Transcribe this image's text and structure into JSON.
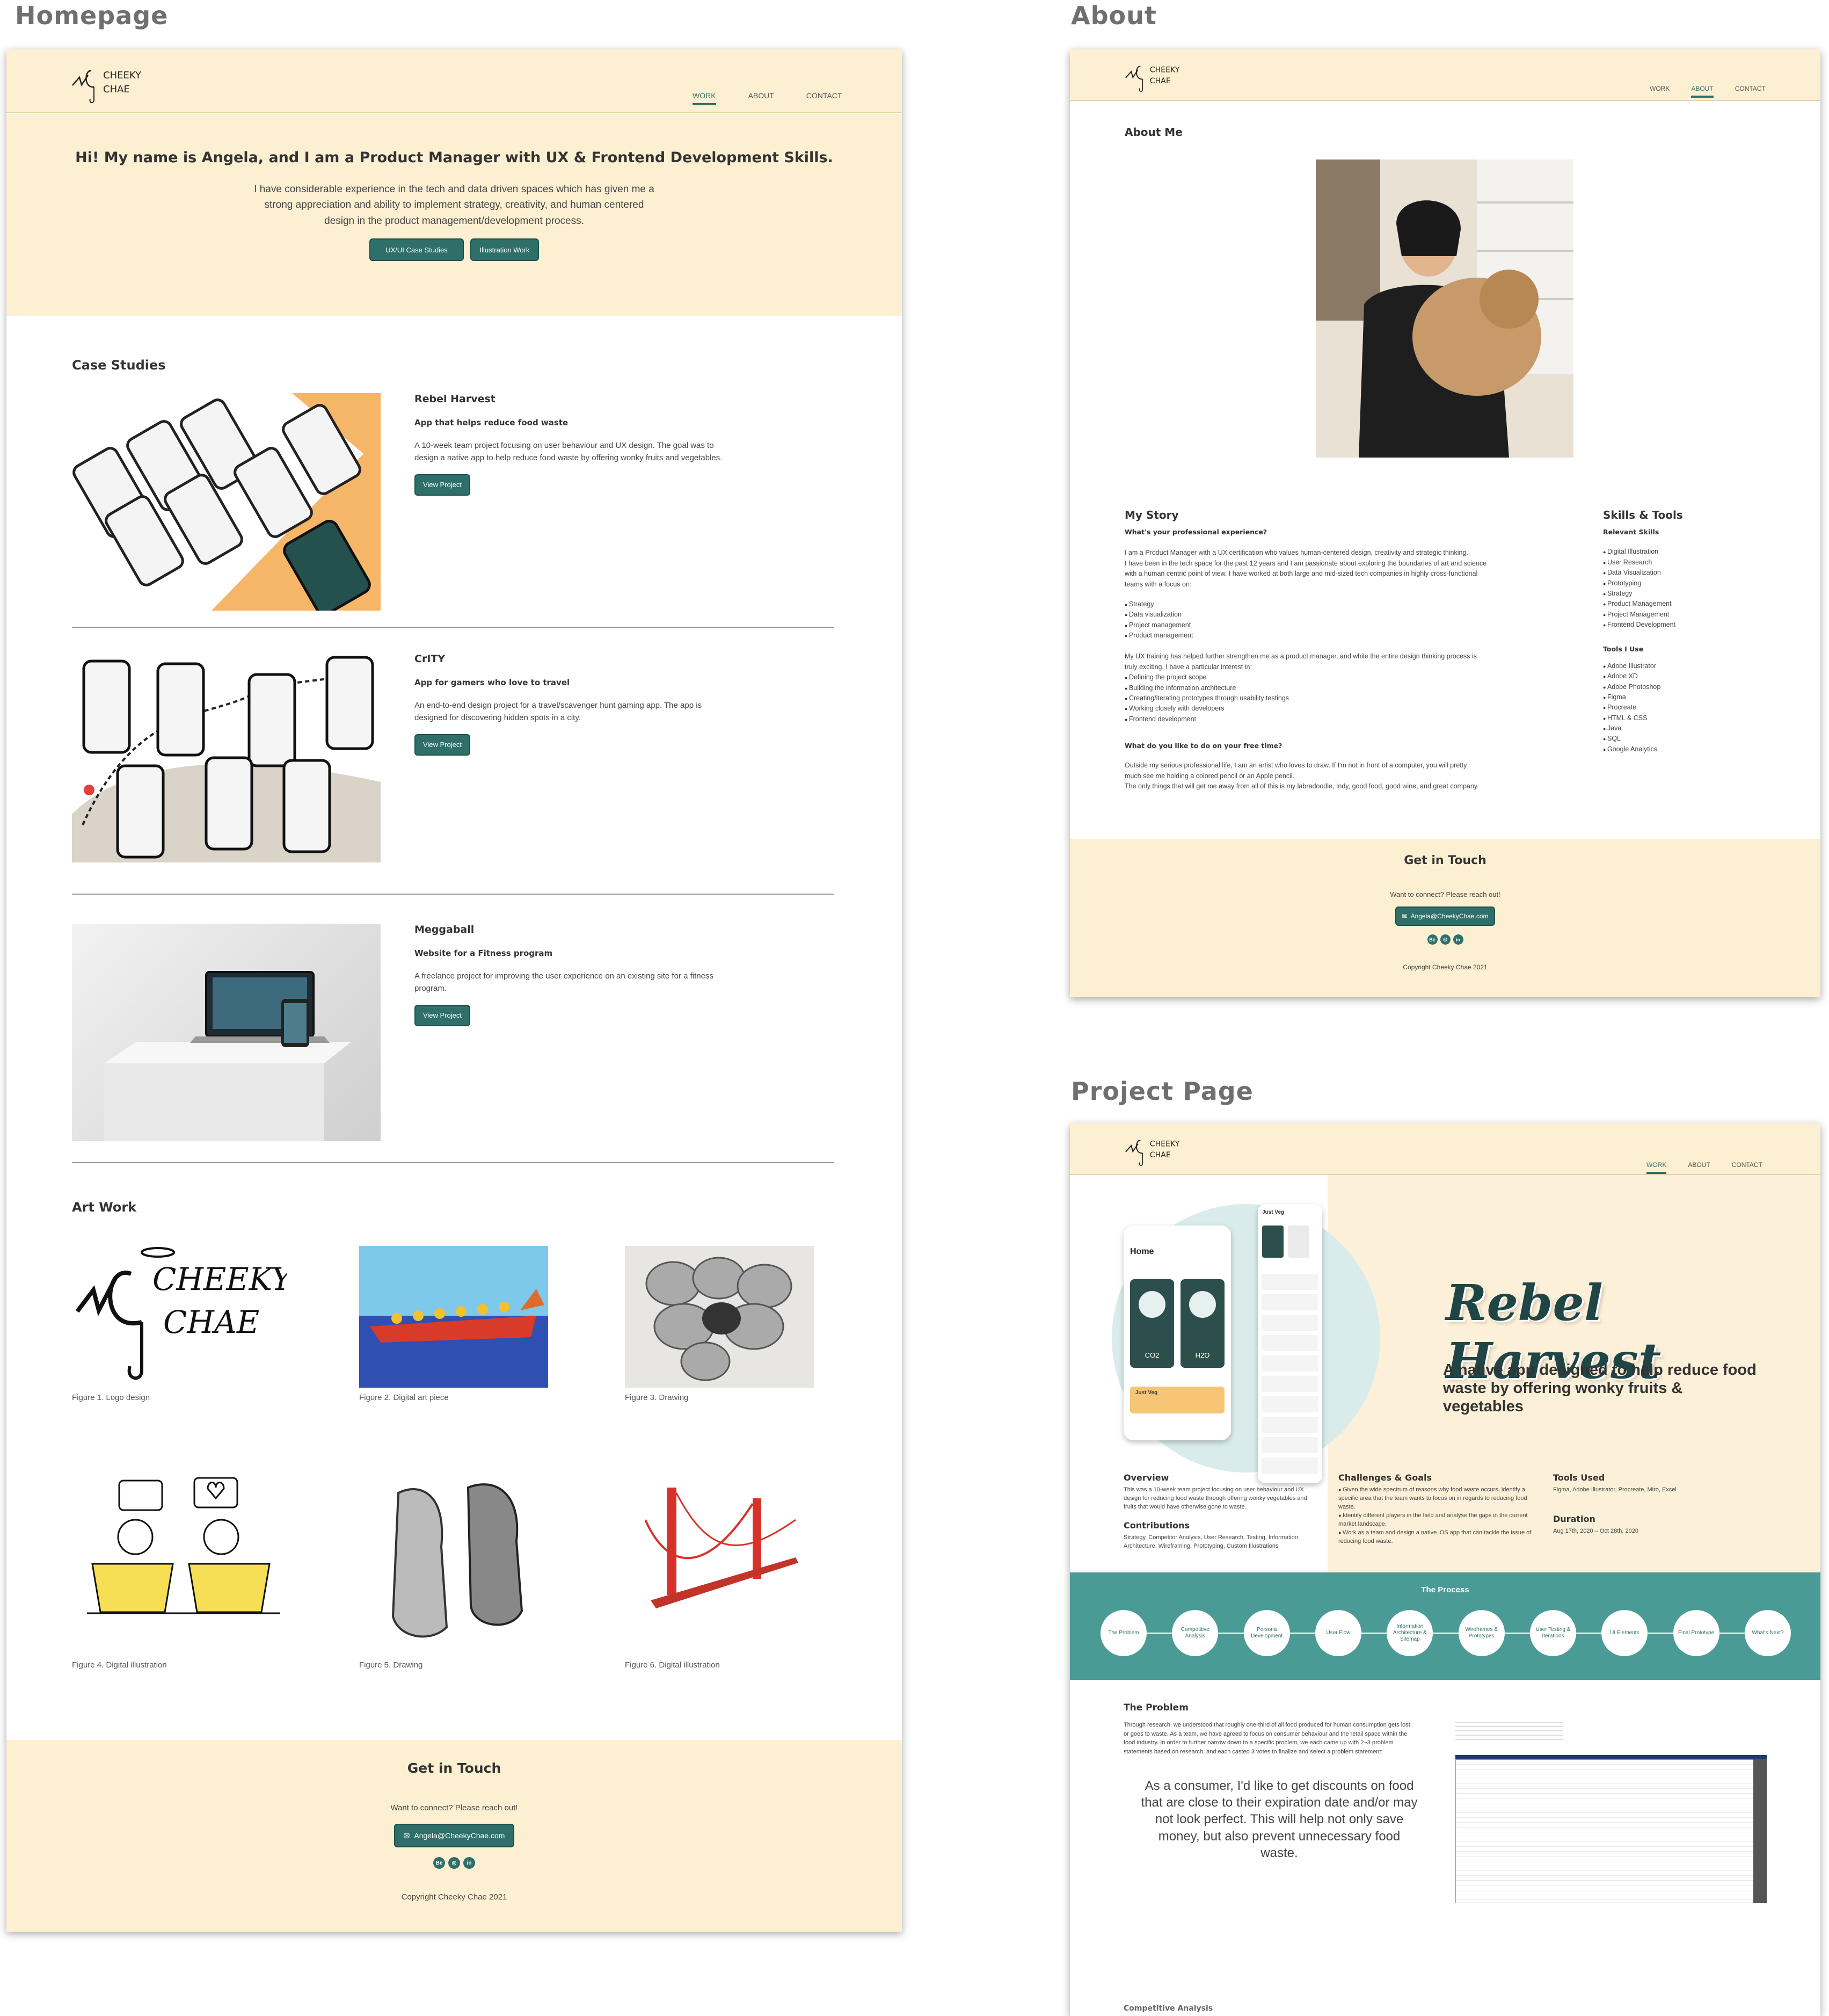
{
  "labels": {
    "homepage": "Homepage",
    "about": "About",
    "project_page": "Project Page"
  },
  "nav": {
    "work": "WORK",
    "about": "ABOUT",
    "contact": "CONTACT"
  },
  "logo": {
    "text1": "CHEEKY",
    "text2": "CHAE"
  },
  "home": {
    "hero_heading": "Hi! My name is Angela, and I am a Product Manager with UX & Frontend Development Skills.",
    "hero_text_1": "I have considerable experience in the tech and data driven spaces which has given me a",
    "hero_text_2": "strong appreciation and ability to implement strategy, creativity, and human centered",
    "hero_text_3": "design in the product management/development process.",
    "btn_case": "UX/UI Case Studies",
    "btn_illus": "Illustration Work",
    "case_studies_title": "Case Studies",
    "projects": [
      {
        "title": "Rebel Harvest",
        "subtitle": "App that helps reduce food waste",
        "desc1": "A 10-week team project focusing on user behaviour and UX design. The goal was to",
        "desc2": "design a native app to help reduce food waste by offering wonky fruits and vegetables.",
        "button": "View Project"
      },
      {
        "title": "CrITY",
        "subtitle": "App for gamers who love to travel",
        "desc1": "An end-to-end design project for a travel/scavenger hunt gaming app. The app is",
        "desc2": "designed for discovering hidden spots in a city.",
        "button": "View Project"
      },
      {
        "title": "Meggaball",
        "subtitle": "Website for a Fitness program",
        "desc1": "A freelance project for improving the user experience on an existing site for a fitness",
        "desc2": "program.",
        "button": "View Project"
      }
    ],
    "art_title": "Art Work",
    "figures": [
      "Figure 1. Logo design",
      "Figure 2. Digital art piece",
      "Figure 3. Drawing",
      "Figure 4. Digital illustration",
      "Figure 5. Drawing",
      "Figure 6. Digital illustration"
    ],
    "contact_title": "Get in Touch",
    "contact_text": "Want to connect? Please reach out!",
    "email": "Angela@CheekyChae.com",
    "copyright": "Copyright Cheeky Chae 2021"
  },
  "about": {
    "about_me": "About Me",
    "story_title": "My Story",
    "q1": "What's your professional experience?",
    "p1_1": "I am a Product Manager with a UX certification who values human-centered design, creativity and strategic thinking.",
    "p1_2": "I have been in the tech space for the past 12 years and I am passionate about exploring the boundaries of art and science",
    "p1_3": "with a human centric point of view. I have worked at both large and mid-sized tech companies in highly cross-functional",
    "p1_4": "teams with a focus on:",
    "focus": [
      "Strategy",
      "Data visualization",
      "Project management",
      "Product management"
    ],
    "p2_1": "My UX training has helped further strengthen me as a product manager, and while the entire design thinking process is",
    "p2_2": "truly exciting, I have a particular interest in:",
    "interests": [
      "Defining the project scope",
      "Building the information architecture",
      "Creating/iterating prototypes through usability testings",
      "Working closely with developers",
      "Frontend development"
    ],
    "q2": "What do you like to do on your free time?",
    "p3_1": "Outside my serious professional life, I am an artist who loves to draw. If I'm not in front of a computer, you will pretty",
    "p3_2": "much see me holding a colored pencil or an Apple pencil.",
    "p3_3": "The only things that will get me away from all of this is my labradoodle, Indy, good food, good wine, and great company.",
    "skills_title": "Skills & Tools",
    "relevant_skills": "Relevant Skills",
    "skills": [
      "Digital Illustration",
      "User Research",
      "Data Visualization",
      "Prototyping",
      "Strategy",
      "Product Management",
      "Project Management",
      "Frontend Development"
    ],
    "tools_title": "Tools I Use",
    "tools": [
      "Adobe Illustrator",
      "Adobe XD",
      "Adobe Photoshop",
      "Figma",
      "Procreate",
      "HTML & CSS",
      "Java",
      "SQL",
      "Google Analytics"
    ],
    "contact_title": "Get in Touch",
    "contact_text": "Want to connect? Please reach out!",
    "email": "Angela@CheekyChae.com",
    "copyright": "Copyright Cheeky Chae 2021"
  },
  "project": {
    "title": "Rebel Harvest",
    "tagline1": "A native app designed to help reduce food",
    "tagline2": "waste by offering wonky fruits &",
    "tagline3": "vegetables",
    "overview_title": "Overview",
    "overview_1": "This was a 10-week team project focusing on user behaviour and UX",
    "overview_2": "design for reducing food waste through offering wonky vegetables and",
    "overview_3": "fruits that would have otherwise gone to waste.",
    "contrib_title": "Contributions",
    "contrib_1": "Strategy, Competitor Analysis, User Research, Testing, Information",
    "contrib_2": "Architecture, Wireframing, Prototyping, Custom Illustrations",
    "challenges_title": "Challenges & Goals",
    "challenge_1": "Given the wide spectrum of reasons why food waste occurs, identify a specific area that the team wants to focus on in regards to reducing food waste.",
    "challenge_2": "Identify different players in the field and analyse the gaps in the current market landscape.",
    "challenge_3": "Work as a team and design a native iOS app that can tackle the issue of reducing food waste.",
    "tools_title": "Tools Used",
    "tools_text": "Figma, Adobe Illustrator, Procreate, Miro, Excel",
    "duration_title": "Duration",
    "duration_text": "Aug 17th, 2020 – Oct 28th, 2020",
    "process_title": "The Process",
    "process": [
      "The Problem",
      "Competitive Analysis",
      "Persona Development",
      "User Flow",
      "Information Architecture & Sitemap",
      "Wireframes & Prototypes",
      "User Testing & Iterations",
      "UI Elements",
      "Final Prototype",
      "What's Next?"
    ],
    "problem_title": "The Problem",
    "problem_1": "Through research, we understood that roughly one-third of all food produced for human consumption gets lost",
    "problem_2": "or goes to waste. As a team, we have agreed to focus on consumer behaviour and the retail space within the",
    "problem_3": "food industry. In order to further narrow down to a specific problem, we each came up with 2~3 problem",
    "problem_4": "statements based on research, and each casted 3 votes to finalize and select a problem statement:",
    "quote": "As a consumer, I'd like to get discounts on food that are close to their expiration date and/or may not look perfect. This will help not only save money, but also prevent unnecessary food waste.",
    "next_section": "Competitive Analysis",
    "app_home": "Home",
    "app_co2": "CO2",
    "app_h2o": "H2O",
    "app_justveg": "Just Veg"
  },
  "colors": {
    "teal": "#2f6f6a",
    "cream": "#fdf0d2",
    "process_bg": "#4a9b96"
  }
}
